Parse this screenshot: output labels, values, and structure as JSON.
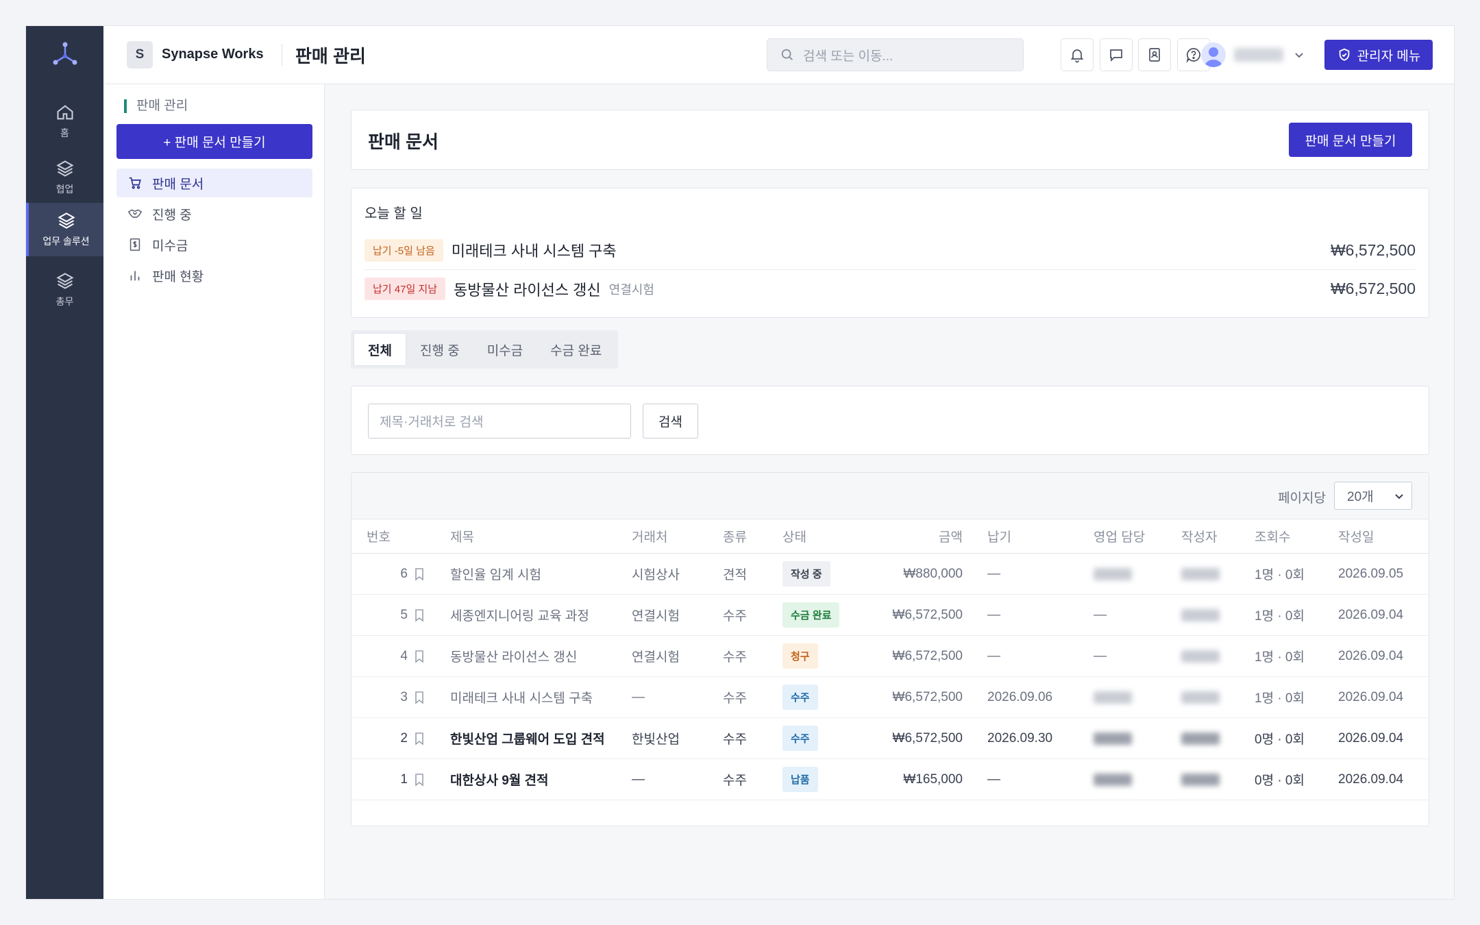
{
  "rail": {
    "items": [
      {
        "label": "홈",
        "icon": "home-icon"
      },
      {
        "label": "협업",
        "icon": "layers-icon"
      },
      {
        "label": "업무 솔루션",
        "icon": "layers-icon",
        "active": true
      },
      {
        "label": "총무",
        "icon": "layers-icon"
      }
    ]
  },
  "topbar": {
    "org_initial": "S",
    "org_name": "Synapse Works",
    "page_title": "판매 관리",
    "search_placeholder": "검색 또는 이동...",
    "admin_label": "관리자 메뉴"
  },
  "sidenav": {
    "section": "판매 관리",
    "create_label": "+ 판매 문서 만들기",
    "items": [
      {
        "label": "판매 문서",
        "icon": "cart-icon",
        "active": true
      },
      {
        "label": "진행 중",
        "icon": "handshake-icon"
      },
      {
        "label": "미수금",
        "icon": "receipt-icon"
      },
      {
        "label": "판매 현황",
        "icon": "bar-chart-icon"
      }
    ]
  },
  "header": {
    "title": "판매 문서",
    "create_label": "판매 문서 만들기"
  },
  "todo": {
    "title": "오늘 할 일",
    "items": [
      {
        "badge": "납기 -5일 남음",
        "name": "미래테크 사내 시스템 구축",
        "sub": "",
        "amount": "₩6,572,500"
      },
      {
        "badge": "납기 47일 지남",
        "name": "동방물산 라이선스 갱신",
        "sub": "연결시험",
        "amount": "₩6,572,500"
      }
    ]
  },
  "tabs": [
    "전체",
    "진행 중",
    "미수금",
    "수금 완료"
  ],
  "search": {
    "placeholder": "제목·거래처로 검색",
    "button": "검색"
  },
  "table": {
    "per_page_label": "페이지당",
    "per_page_value": "20개",
    "columns": [
      "번호",
      "제목",
      "거래처",
      "종류",
      "상태",
      "금액",
      "납기",
      "영업 담당",
      "작성자",
      "조회수",
      "작성일"
    ],
    "rows": [
      {
        "no": "6",
        "title": "할인율 임계 시험",
        "client": "시험상사",
        "kind": "견적",
        "status": "작성 중",
        "status_type": "draft",
        "amount": "₩880,000",
        "due": "—",
        "sales": "",
        "author": "",
        "views": "1명 · 0회",
        "date": "2026.09.05"
      },
      {
        "no": "5",
        "title": "세종엔지니어링 교육 과정",
        "client": "연결시험",
        "kind": "수주",
        "status": "수금 완료",
        "status_type": "done",
        "amount": "₩6,572,500",
        "due": "—",
        "sales": "—",
        "author": "",
        "views": "1명 · 0회",
        "date": "2026.09.04"
      },
      {
        "no": "4",
        "title": "동방물산 라이선스 갱신",
        "client": "연결시험",
        "kind": "수주",
        "status": "청구",
        "status_type": "bill",
        "amount": "₩6,572,500",
        "due": "—",
        "sales": "—",
        "author": "",
        "views": "1명 · 0회",
        "date": "2026.09.04"
      },
      {
        "no": "3",
        "title": "미래테크 사내 시스템 구축",
        "client": "—",
        "kind": "수주",
        "status": "수주",
        "status_type": "order",
        "amount": "₩6,572,500",
        "due": "2026.09.06",
        "sales": "",
        "author": "",
        "views": "1명 · 0회",
        "date": "2026.09.04"
      },
      {
        "no": "2",
        "title": "한빛산업 그룹웨어 도입 견적",
        "client": "한빛산업",
        "kind": "수주",
        "status": "수주",
        "status_type": "order",
        "amount": "₩6,572,500",
        "due": "2026.09.30",
        "sales": "",
        "author": "",
        "views": "0명 · 0회",
        "date": "2026.09.04",
        "strong": true
      },
      {
        "no": "1",
        "title": "대한상사 9월 견적",
        "client": "—",
        "kind": "수주",
        "status": "납품",
        "status_type": "order",
        "amount": "₩165,000",
        "due": "—",
        "sales": "",
        "author": "",
        "views": "0명 · 0회",
        "date": "2026.09.04",
        "strong": true
      }
    ]
  },
  "colors": {
    "primary": "#3b35c9",
    "rail": "#2b3347",
    "accent_teal": "#1f8a7a"
  }
}
